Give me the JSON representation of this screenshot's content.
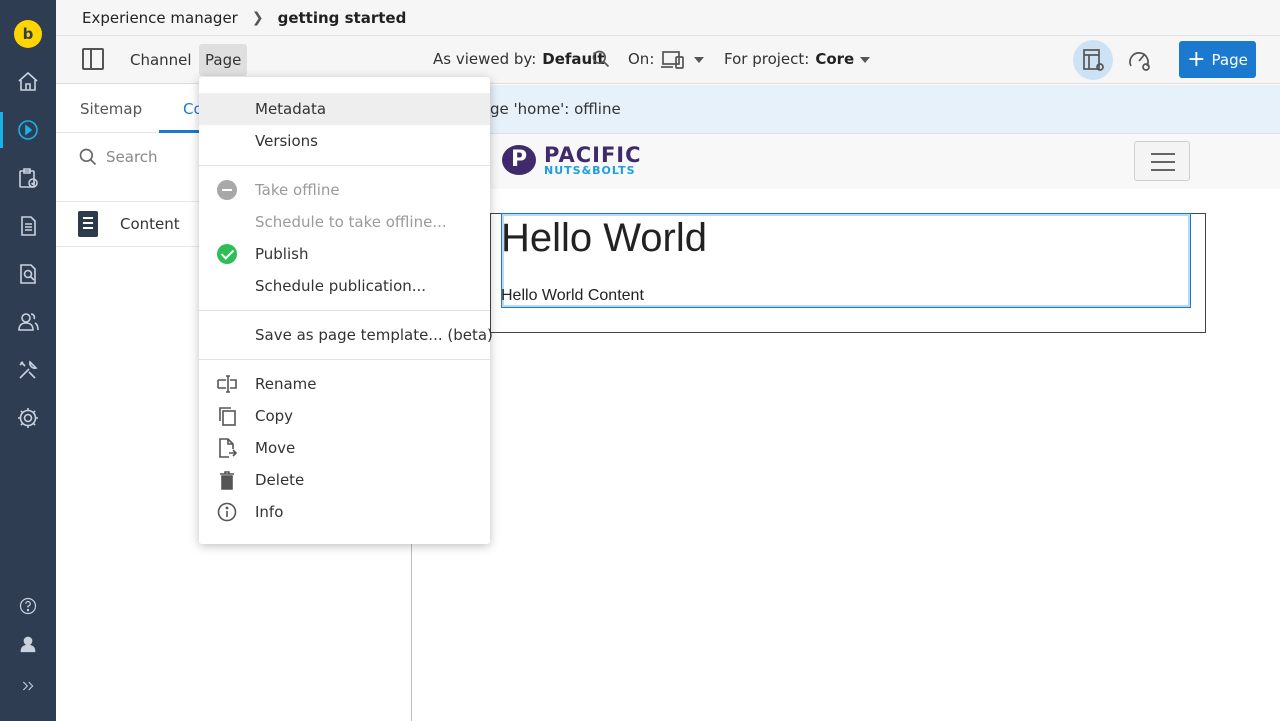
{
  "breadcrumb": {
    "root": "Experience manager",
    "current": "getting started"
  },
  "toolbar": {
    "channel_label": "Channel",
    "page_label": "Page",
    "viewed_by_label": "As viewed by:",
    "viewed_by_value": "Default",
    "on_label": "On:",
    "project_label": "For project:",
    "project_value": "Core",
    "add_page_label": "Page"
  },
  "left_panel": {
    "tabs": [
      "Sitemap",
      "Co"
    ],
    "search_placeholder": "Search",
    "tree": [
      {
        "label": "Content"
      }
    ]
  },
  "status_text": "ge 'home': offline",
  "canvas": {
    "brand_line1": "PACIFIC",
    "brand_line2": "NUTS&BOLTS",
    "heading": "Hello World",
    "body": "Hello World Content"
  },
  "menu": {
    "metadata": "Metadata",
    "versions": "Versions",
    "take_offline": "Take offline",
    "schedule_offline": "Schedule to take offline...",
    "publish": "Publish",
    "schedule_publication": "Schedule publication...",
    "save_template": "Save as page template... (beta)",
    "rename": "Rename",
    "copy": "Copy",
    "move": "Move",
    "delete": "Delete",
    "info": "Info"
  },
  "rail": {
    "logo_letter": "b",
    "icons": [
      "home-icon",
      "experience-manager-icon",
      "projects-icon",
      "content-icon",
      "search-content-icon",
      "users-icon",
      "tools-icon",
      "settings-icon",
      "help-icon",
      "user-icon",
      "expand-icon"
    ]
  },
  "colors": {
    "accent": "#1c79d0",
    "rail": "#2f3d52",
    "active_rail": "#1ab0e8",
    "publish": "#2fbe55"
  }
}
